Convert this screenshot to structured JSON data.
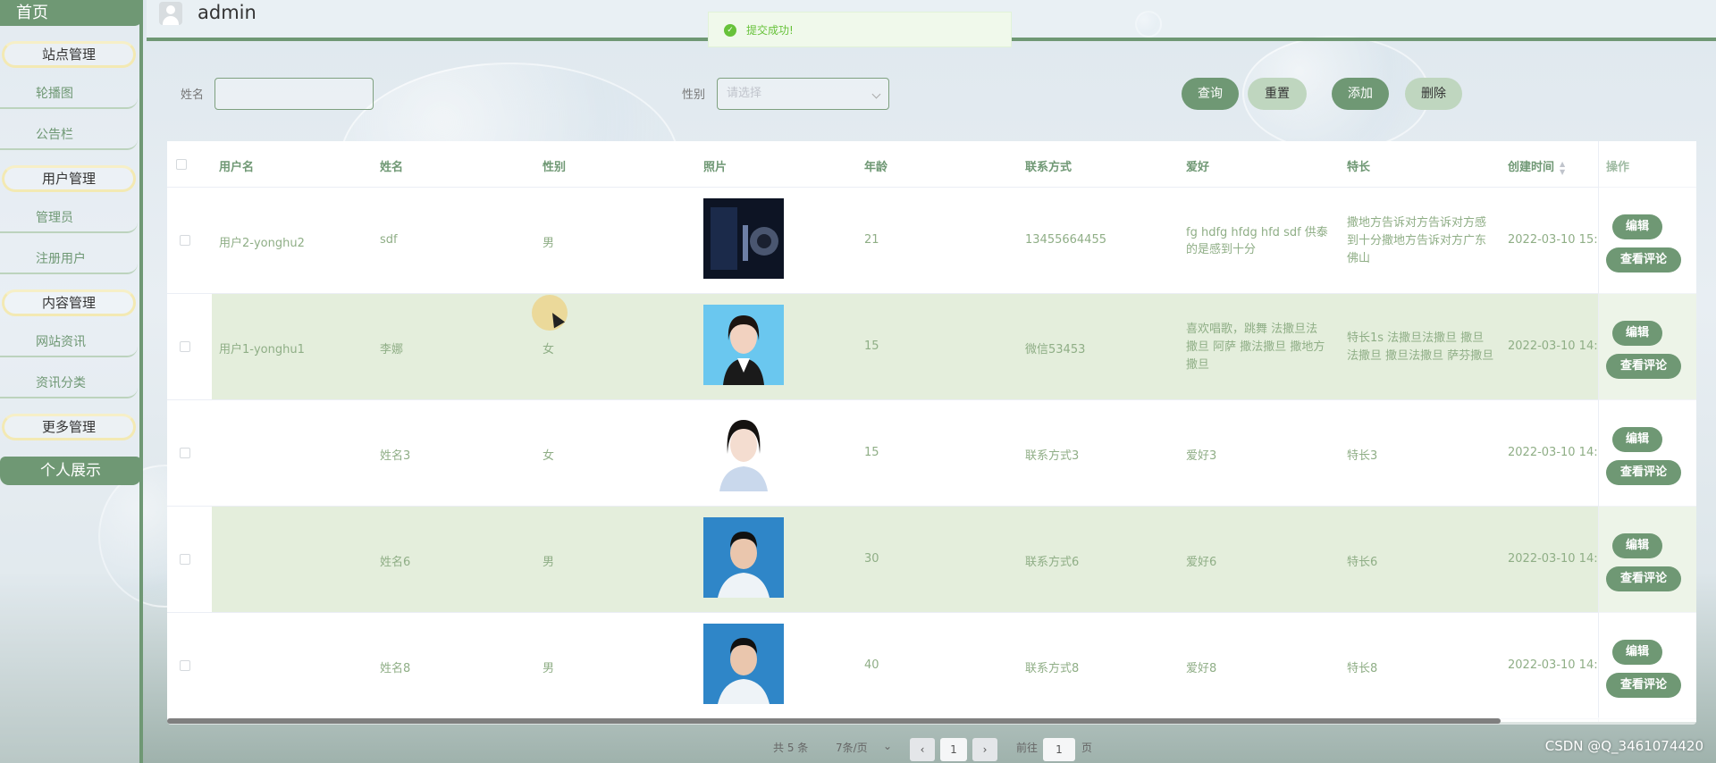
{
  "sidebar": {
    "home": "首页",
    "groups": [
      {
        "title": "站点管理",
        "items": [
          "轮播图",
          "公告栏"
        ]
      },
      {
        "title": "用户管理",
        "items": [
          "管理员",
          "注册用户"
        ]
      },
      {
        "title": "内容管理",
        "items": [
          "网站资讯",
          "资讯分类"
        ]
      },
      {
        "title": "更多管理",
        "items": []
      }
    ],
    "display_btn": "个人展示"
  },
  "header": {
    "username": "admin"
  },
  "toast": {
    "message": "提交成功!"
  },
  "search": {
    "name_label": "姓名",
    "name_value": "",
    "gender_label": "性别",
    "gender_placeholder": "请选择",
    "query": "查询",
    "reset": "重置",
    "add": "添加",
    "delete": "删除"
  },
  "table": {
    "columns": [
      "用户名",
      "姓名",
      "性别",
      "照片",
      "年龄",
      "联系方式",
      "爱好",
      "特长",
      "创建时间",
      "操作"
    ],
    "rows": [
      {
        "username": "用户2-yonghu2",
        "name": "sdf",
        "gender": "男",
        "age": "21",
        "contact": "13455664455",
        "hobby": "fg hdfg hfdg hfd sdf 供泰的是感到十分",
        "skill": "撒地方告诉对方告诉对方感到十分撒地方告诉对方广东佛山",
        "created": "2022-03-10 15:"
      },
      {
        "username": "用户1-yonghu1",
        "name": "李娜",
        "gender": "女",
        "age": "15",
        "contact": "微信53453",
        "hobby": "喜欢唱歌，跳舞 法撒旦法撒旦 阿萨 撒法撒旦 撒地方撒旦",
        "skill": "特长1s 法撒旦法撒旦 撒旦法撒旦 撒旦法撒旦 萨芬撒旦",
        "created": "2022-03-10 14:"
      },
      {
        "username": "",
        "name": "姓名3",
        "gender": "女",
        "age": "15",
        "contact": "联系方式3",
        "hobby": "爱好3",
        "skill": "特长3",
        "created": "2022-03-10 14:"
      },
      {
        "username": "",
        "name": "姓名6",
        "gender": "男",
        "age": "30",
        "contact": "联系方式6",
        "hobby": "爱好6",
        "skill": "特长6",
        "created": "2022-03-10 14:"
      },
      {
        "username": "",
        "name": "姓名8",
        "gender": "男",
        "age": "40",
        "contact": "联系方式8",
        "hobby": "爱好8",
        "skill": "特长8",
        "created": "2022-03-10 14:"
      }
    ],
    "edit": "编辑",
    "view_comments": "查看评论"
  },
  "pagination": {
    "total": "共 5 条",
    "page_size": "7条/页",
    "current": "1",
    "goto_prefix": "前往",
    "goto_value": "1",
    "goto_suffix": "页"
  },
  "watermark": "CSDN @Q_3461074420"
}
